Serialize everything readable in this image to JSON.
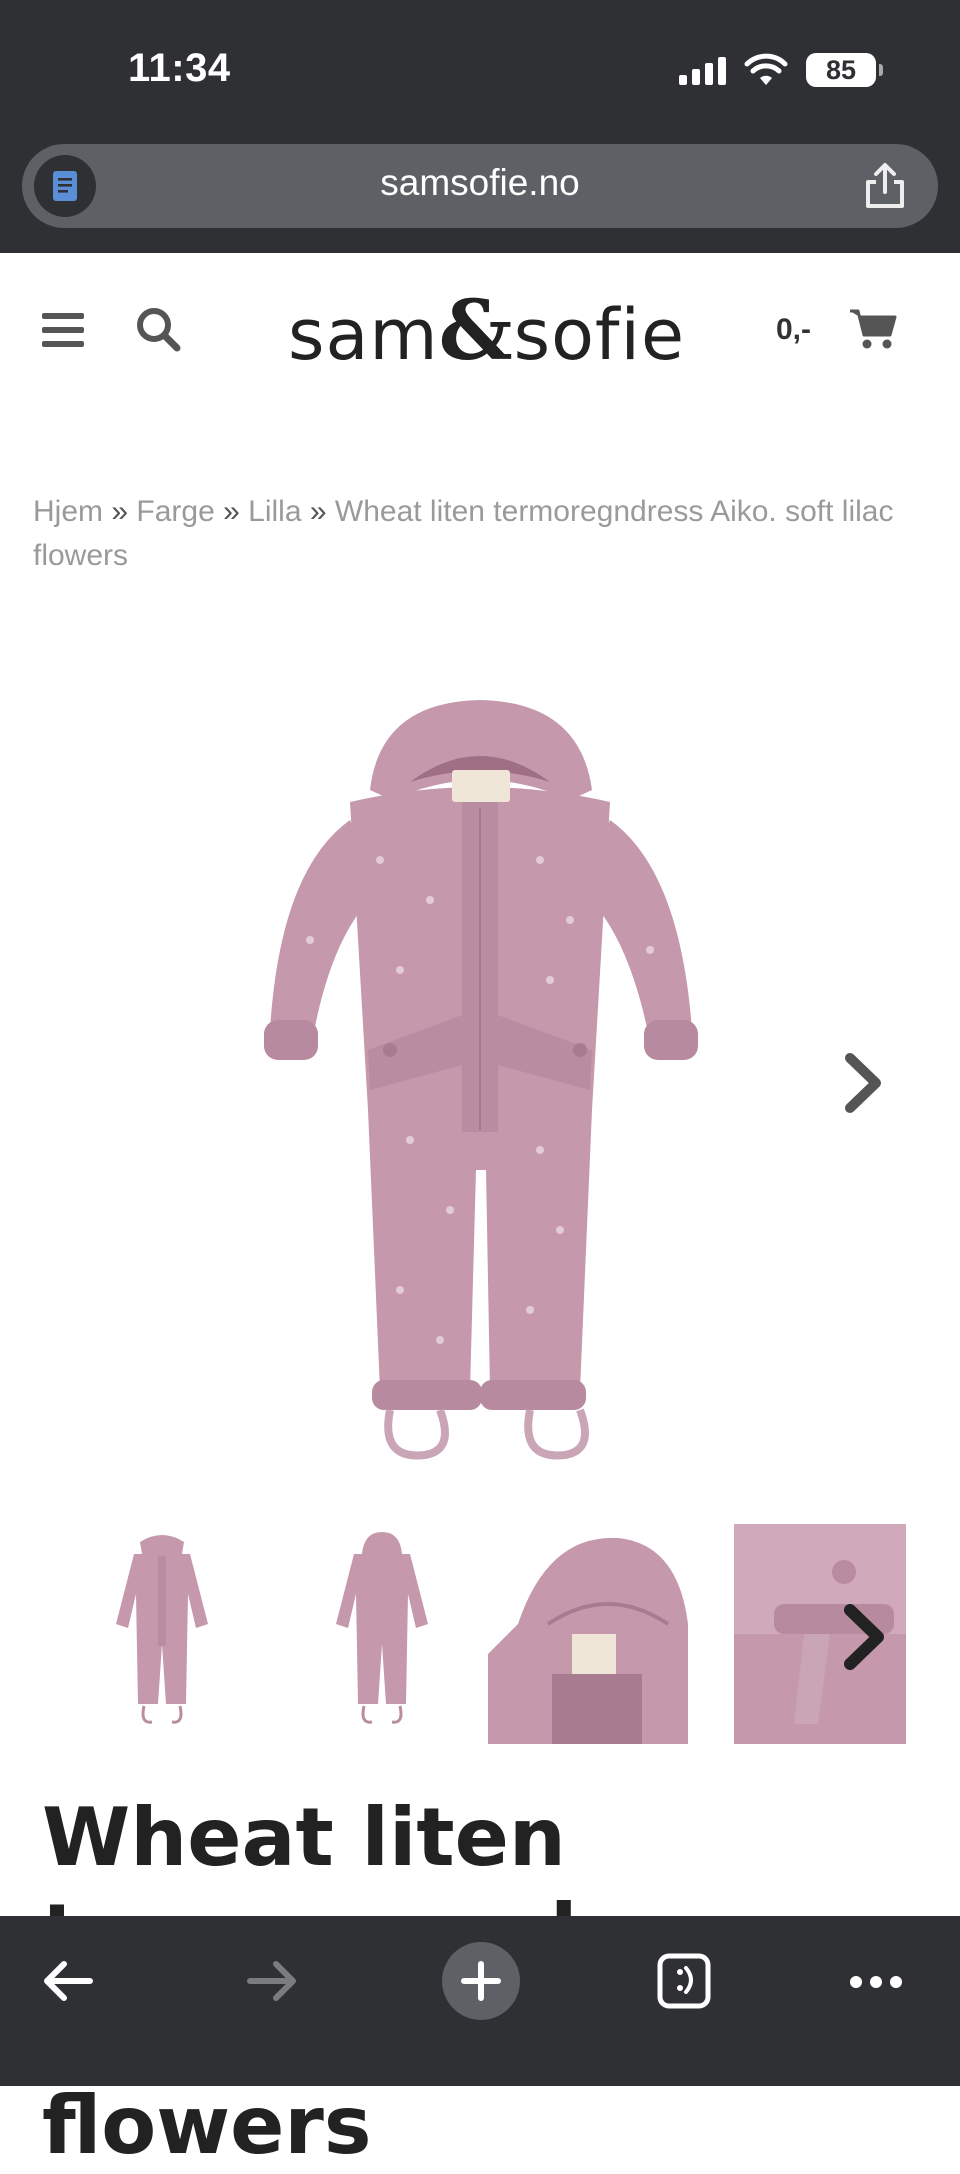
{
  "status_bar": {
    "time": "11:34",
    "battery": "85",
    "icons": [
      "signal-icon",
      "wifi-icon",
      "battery-icon"
    ]
  },
  "browser": {
    "url": "samsofie.no",
    "toolbar_icons": [
      "back-arrow-icon",
      "forward-arrow-icon",
      "new-tab-plus-icon",
      "tabs-icon",
      "more-dots-icon"
    ]
  },
  "header": {
    "logo_left": "sam",
    "logo_amp": "&",
    "logo_right": "sofie",
    "cart_total": "0,-",
    "icons": [
      "hamburger-menu-icon",
      "search-icon",
      "shopping-cart-icon"
    ]
  },
  "breadcrumb": {
    "items": [
      "Hjem",
      "Farge",
      "Lilla"
    ],
    "separator": "»",
    "current": "Wheat liten termoregndress Aiko. soft lilac flowers"
  },
  "gallery": {
    "thumbnail_count": 4,
    "colors": {
      "suit": "#c598ac",
      "suit_dark": "#a97b90",
      "suit_light": "#d6b3c3"
    }
  },
  "product": {
    "title": "Wheat liten termoregndress Aiko. soft lilac flowers"
  }
}
